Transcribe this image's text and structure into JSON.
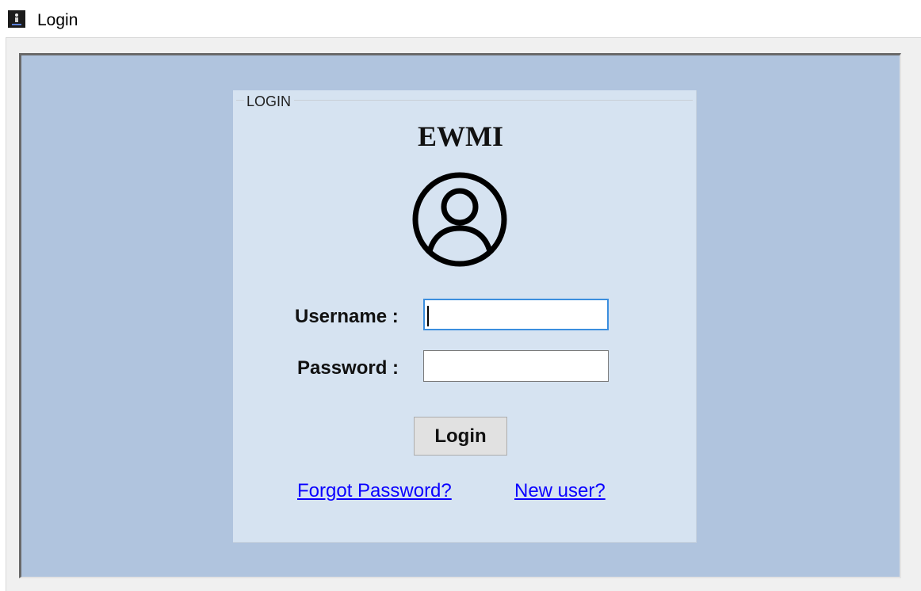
{
  "window": {
    "title": "Login",
    "icon": "app-icon"
  },
  "group_box": {
    "label": "LOGIN"
  },
  "brand": {
    "name": "EWMI",
    "avatar_icon": "user-circle-icon"
  },
  "form": {
    "username_label": "Username :",
    "username_value": "",
    "password_label": "Password :",
    "password_value": ""
  },
  "actions": {
    "login_label": "Login",
    "forgot_password_label": "Forgot Password?",
    "new_user_label": "New user?"
  },
  "colors": {
    "client_background": "#b0c4de",
    "panel_background": "#d6e3f1",
    "link": "#0a00ff",
    "focus_border": "#3b8ede"
  }
}
